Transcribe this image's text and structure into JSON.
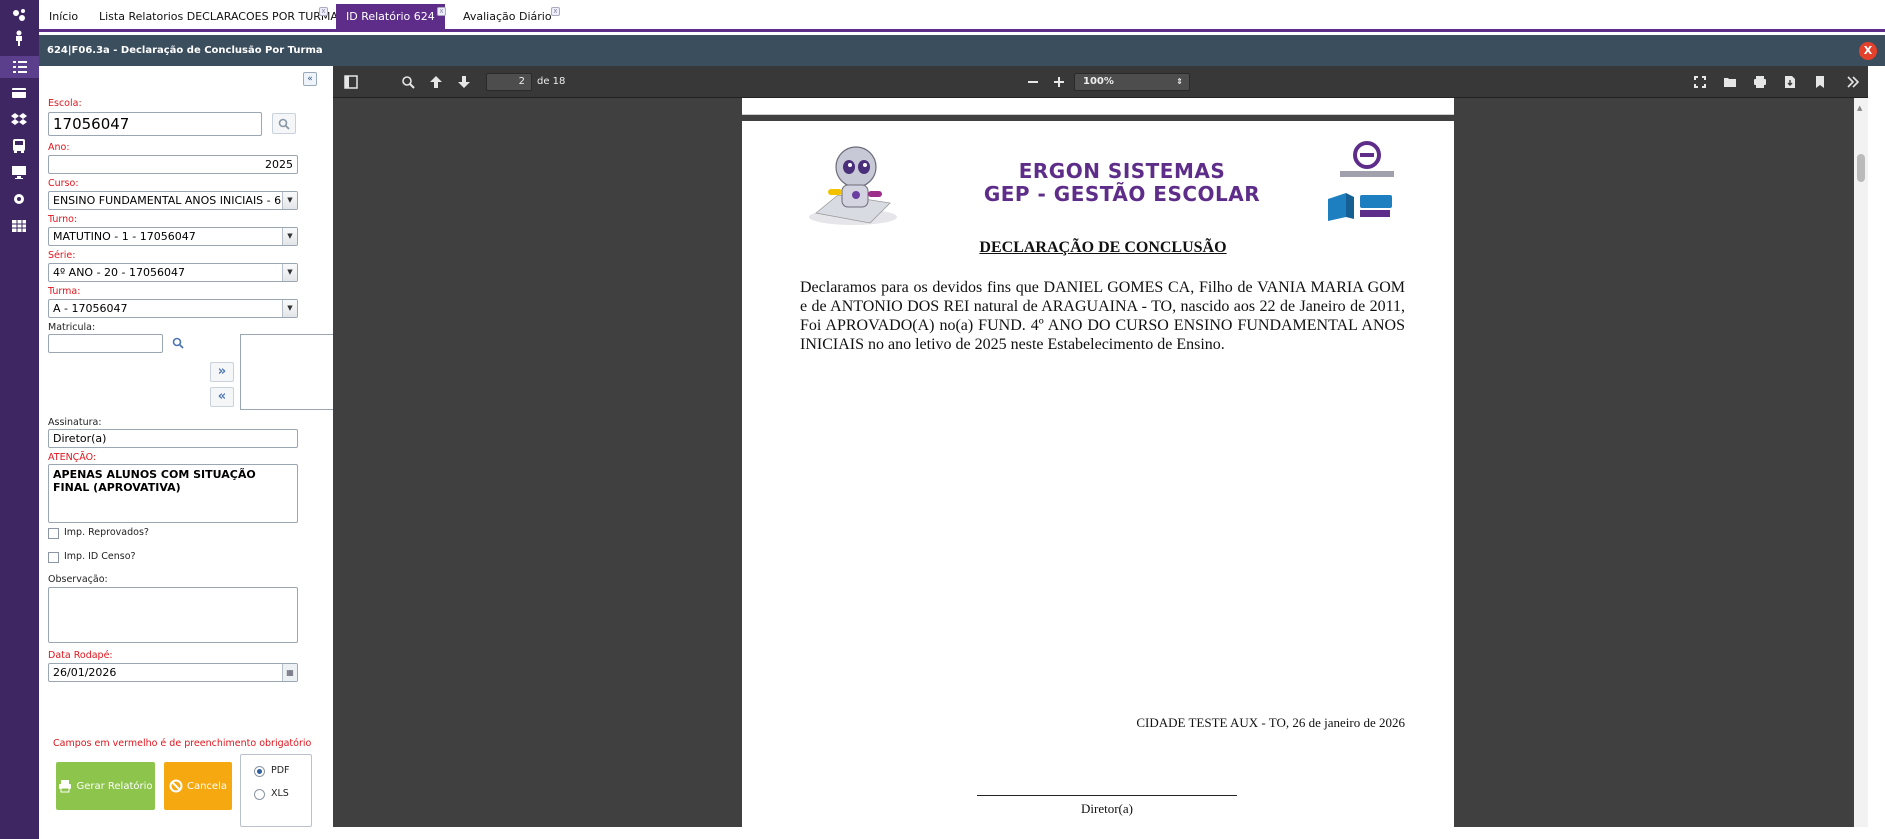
{
  "tabs": [
    {
      "label": "Início"
    },
    {
      "label": "Lista Relatorios DECLARACOES POR TURMA"
    },
    {
      "label": "ID Relatório 624"
    },
    {
      "label": "Avaliação Diário"
    }
  ],
  "window": {
    "title": "624|F06.3a - Declaração de Conclusão Por Turma",
    "close_label": "X"
  },
  "form": {
    "escola": {
      "label": "Escola:",
      "value": "17056047"
    },
    "ano": {
      "label": "Ano:",
      "value": "2025"
    },
    "curso": {
      "label": "Curso:",
      "value": "ENSINO FUNDAMENTAL ANOS INICIAIS - 6"
    },
    "turno": {
      "label": "Turno:",
      "value": "MATUTINO - 1 - 17056047"
    },
    "serie": {
      "label": "Série:",
      "value": "4º ANO - 20 - 17056047"
    },
    "turma": {
      "label": "Turma:",
      "value": "A - 17056047"
    },
    "matricula": {
      "label": "Matricula:",
      "value": ""
    },
    "assinatura": {
      "label": "Assinatura:",
      "value": "Diretor(a)"
    },
    "atencao": {
      "label": "ATENÇÃO:",
      "value": "APENAS ALUNOS COM SITUAÇÃO FINAL (APROVATIVA)"
    },
    "imp_reprovados": {
      "label": "Imp. Reprovados?"
    },
    "imp_id_censo": {
      "label": "Imp. ID Censo?"
    },
    "observacao": {
      "label": "Observação:",
      "value": ""
    },
    "data_rodape": {
      "label": "Data Rodapé:",
      "value": "26/01/2026"
    },
    "required_note": "Campos em vermelho é de preenchimento obrigatório",
    "gerar_label": "Gerar Relatório",
    "cancela_label": "Cancela",
    "formats": [
      {
        "label": "PDF",
        "selected": true
      },
      {
        "label": "XLS",
        "selected": false
      }
    ]
  },
  "viewer": {
    "page_current": "2",
    "page_total": "de 18",
    "zoom": "100%"
  },
  "document": {
    "brand_line1": "ERGON SISTEMAS",
    "brand_line2": "GEP - GESTÃO ESCOLAR",
    "title": "DECLARAÇÃO DE CONCLUSÃO",
    "body": "Declaramos para os devidos fins que DANIEL GOMES CA, Filho de VANIA MARIA GOM e de ANTONIO DOS REI natural de ARAGUAINA - TO, nascido aos 22 de Janeiro de 2011, Foi APROVADO(A) no(a) FUND. 4º ANO DO CURSO ENSINO FUNDAMENTAL ANOS INICIAIS no ano letivo de 2025 neste Estabelecimento de Ensino.",
    "date_line": "CIDADE TESTE AUX - TO, 26 de janeiro de 2026",
    "signature": "Diretor(a)"
  },
  "colors": {
    "rail": "#3e2663",
    "accent": "#5e2d8a",
    "titlebar": "#3b4e5e",
    "required": "#e0151c",
    "btn_green": "#8dc54c",
    "btn_orange": "#f5a80f"
  }
}
